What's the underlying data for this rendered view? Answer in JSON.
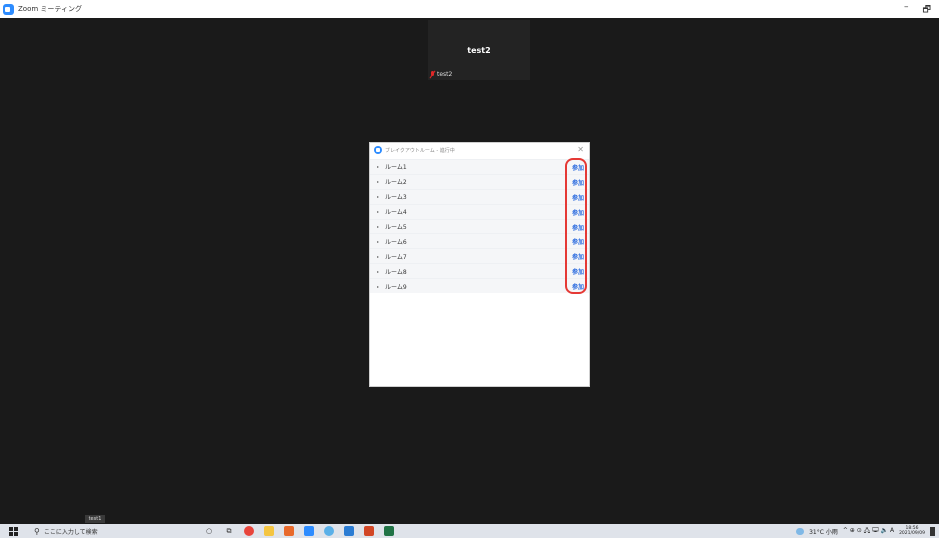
{
  "window": {
    "title": "Zoom ミーティング",
    "minimize": "–",
    "maximize": "🗗"
  },
  "participant": {
    "name": "test2",
    "label": "test2"
  },
  "self_label": "test1",
  "breakout": {
    "title": "ブレイクアウトルーム - 進行中",
    "close": "✕",
    "join_label": "参加",
    "rooms": [
      "ルーム1",
      "ルーム2",
      "ルーム3",
      "ルーム4",
      "ルーム5",
      "ルーム6",
      "ルーム7",
      "ルーム8",
      "ルーム9"
    ]
  },
  "taskbar": {
    "search_placeholder": "ここに入力して検索",
    "weather": "31°C 小雨",
    "tray_icons": "^ ⊕ ⊙ 🖧 🖵 🔈 A",
    "time": "18:56",
    "date": "2021/09/09"
  },
  "colors": {
    "accent": "#2d8cff",
    "highlight": "#e53935",
    "background": "#1a1a1a"
  }
}
